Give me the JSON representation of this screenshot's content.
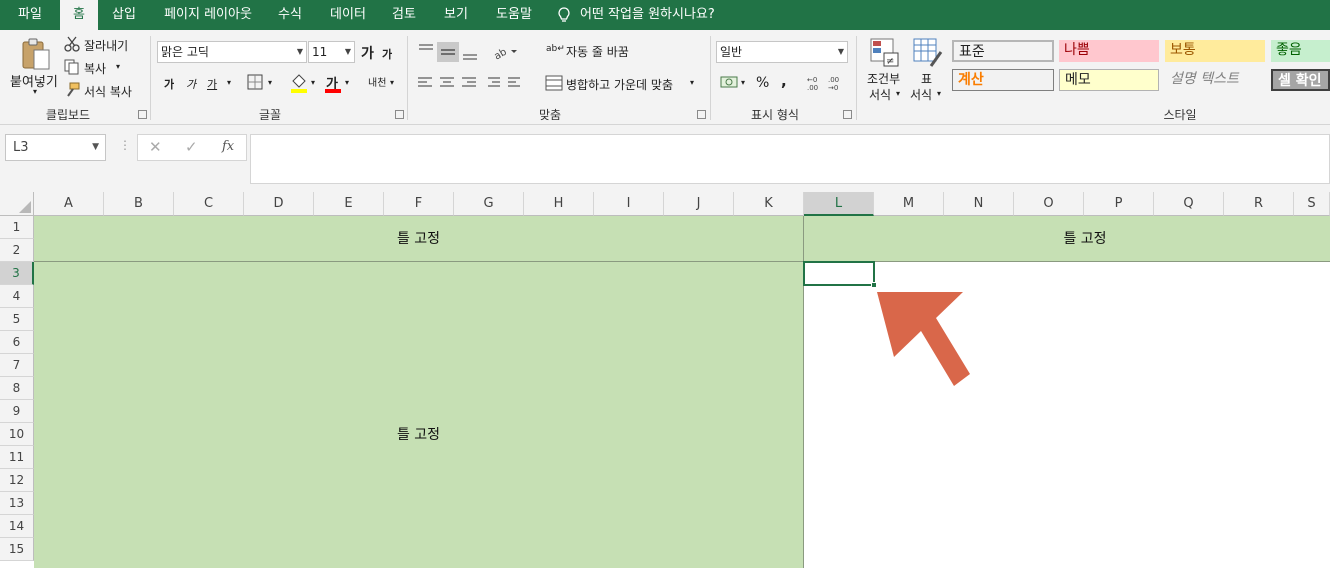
{
  "menu": {
    "tabs": [
      "파일",
      "홈",
      "삽입",
      "페이지 레이아웃",
      "수식",
      "데이터",
      "검토",
      "보기",
      "도움말"
    ],
    "active": "홈",
    "tell_me": "어떤 작업을 원하시나요?"
  },
  "ribbon": {
    "clipboard": {
      "paste": "붙여넣기",
      "cut": "잘라내기",
      "copy": "복사",
      "format_painter": "서식 복사",
      "group": "클립보드"
    },
    "font": {
      "name": "맑은 고딕",
      "size": "11",
      "grow": "가",
      "shrink": "가",
      "bold": "가",
      "italic": "가",
      "underline": "가",
      "font_color": "가",
      "phonetic": "내천",
      "group": "글꼴"
    },
    "alignment": {
      "wrap": "자동 줄 바꿈",
      "merge": "병합하고 가운데 맞춤",
      "group": "맞춤"
    },
    "number": {
      "format": "일반",
      "percent": "%",
      "comma": ",",
      "group": "표시 형식"
    },
    "styles": {
      "conditional": "조건부\n서식",
      "conditional_1": "조건부",
      "conditional_2": "서식",
      "table_1": "표",
      "table_2": "서식",
      "boxes": [
        {
          "label": "표준",
          "color": "#000000",
          "bg": "#ffffff"
        },
        {
          "label": "나쁨",
          "color": "#9c0006",
          "bg": "#ffc7ce"
        },
        {
          "label": "보통",
          "color": "#9c5700",
          "bg": "#ffeb9c"
        },
        {
          "label": "좋음",
          "color": "#006100",
          "bg": "#c6efce"
        },
        {
          "label": "계산",
          "color": "#fa7d00",
          "bg": "#f2f2f2"
        },
        {
          "label": "메모",
          "color": "#000000",
          "bg": "#ffffcc"
        },
        {
          "label": "설명 텍스트",
          "color": "#7f7f7f",
          "bg": "#f3f3f3"
        },
        {
          "label": "셀 확인",
          "color": "#ffffff",
          "bg": "#a5a5a5"
        }
      ],
      "group": "스타일"
    }
  },
  "formula_bar": {
    "name_box": "L3",
    "fx": "fx",
    "content": ""
  },
  "grid": {
    "columns": [
      "A",
      "B",
      "C",
      "D",
      "E",
      "F",
      "G",
      "H",
      "I",
      "J",
      "K",
      "L",
      "M",
      "N",
      "O",
      "P",
      "Q",
      "R",
      "S"
    ],
    "rows": [
      "1",
      "2",
      "3",
      "4",
      "5",
      "6",
      "7",
      "8",
      "9",
      "10",
      "11",
      "12",
      "13",
      "14",
      "15"
    ],
    "selected_cell": "L3",
    "freeze_top_left": "틀 고정",
    "freeze_top_right": "틀 고정",
    "freeze_left": "틀 고정",
    "fill_color": "#c6e0b4",
    "arrow_color": "#d9674a"
  }
}
